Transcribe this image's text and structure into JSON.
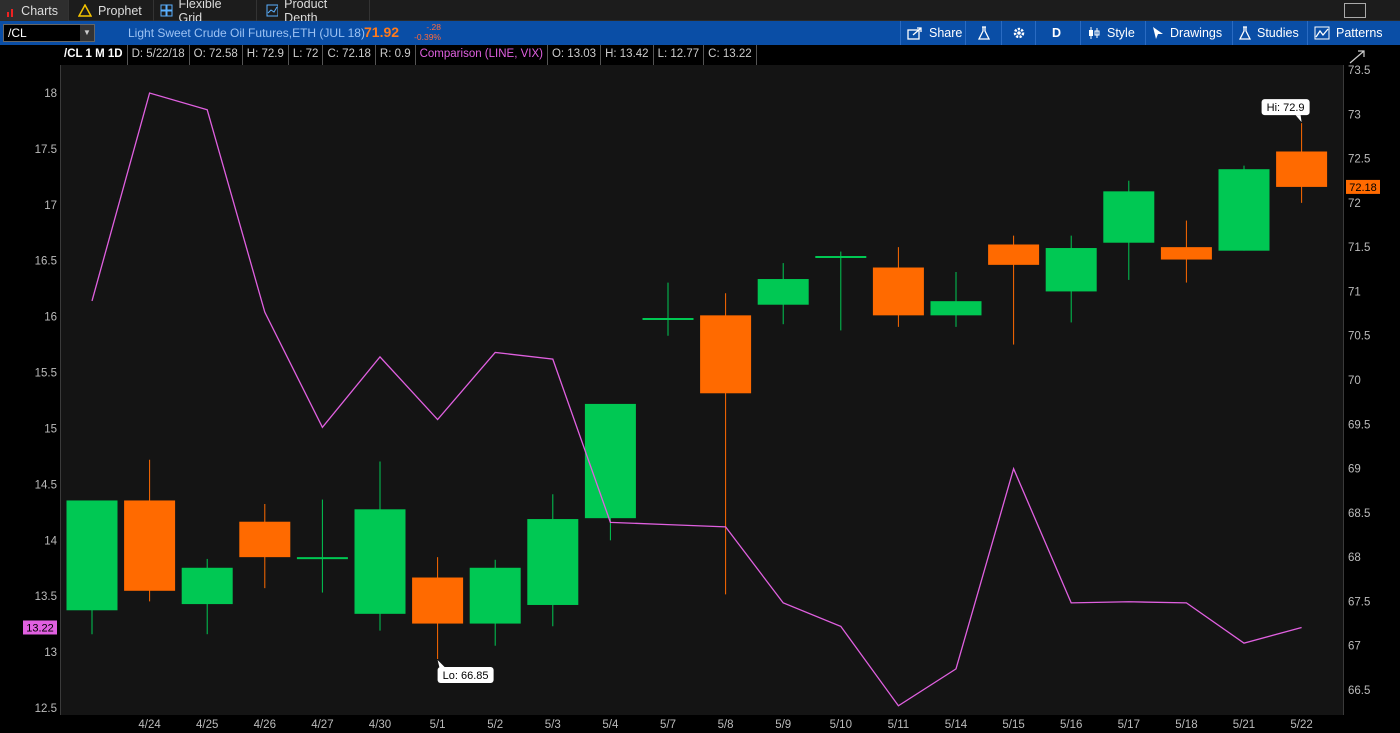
{
  "tabs": [
    {
      "label": "Charts",
      "icon": "bar-chart-icon",
      "active": true
    },
    {
      "label": "Prophet",
      "icon": "warning-triangle-icon",
      "active": false
    },
    {
      "label": "Flexible Grid",
      "icon": "grid-icon",
      "active": false
    },
    {
      "label": "Product Depth",
      "icon": "chart-icon",
      "active": false
    }
  ],
  "toolbar": {
    "symbol": "/CL",
    "description": "Light Sweet Crude Oil Futures,ETH (JUL 18)",
    "last_price": "71.92",
    "change": "-.28",
    "change_pct": "-0.39%",
    "share_label": "Share",
    "aggregation_label": "D",
    "style_label": "Style",
    "drawings_label": "Drawings",
    "studies_label": "Studies",
    "patterns_label": "Patterns"
  },
  "infobar": {
    "symbol_period": "/CL 1 M 1D",
    "date": "D: 5/22/18",
    "open": "O: 72.58",
    "high": "H: 72.9",
    "low": "L: 72",
    "close": "C: 72.18",
    "range": "R: 0.9",
    "comparison": "Comparison (LINE, VIX)",
    "cmp_open": "O: 13.03",
    "cmp_high": "H: 13.42",
    "cmp_low": "L: 12.77",
    "cmp_close": "C: 13.22"
  },
  "colors": {
    "up": "#00c853",
    "down": "#ff6a00",
    "comparison_line": "#e060e0",
    "price_tag": "#ff6a00",
    "cmp_tag": "#e060e0"
  },
  "chart_data": {
    "type": "candlestick",
    "dates": [
      "4/24",
      "4/25",
      "4/26",
      "4/27",
      "4/30",
      "5/1",
      "5/2",
      "5/3",
      "5/4",
      "5/7",
      "5/8",
      "5/9",
      "5/10",
      "5/11",
      "5/14",
      "5/15",
      "5/16",
      "5/17",
      "5/18",
      "5/21",
      "5/22"
    ],
    "ohlc": [
      [
        67.4,
        68.57,
        67.13,
        68.64
      ],
      [
        68.64,
        69.1,
        67.5,
        67.62
      ],
      [
        67.47,
        67.98,
        67.13,
        67.88
      ],
      [
        68.4,
        68.6,
        67.65,
        68.0
      ],
      [
        68.0,
        68.65,
        67.6,
        68.0
      ],
      [
        67.36,
        69.08,
        67.17,
        68.54
      ],
      [
        67.77,
        68.0,
        66.85,
        67.25
      ],
      [
        67.25,
        67.97,
        67.0,
        67.88
      ],
      [
        67.46,
        68.71,
        67.22,
        68.43
      ],
      [
        68.44,
        69.42,
        68.19,
        69.73
      ],
      [
        70.7,
        71.1,
        70.5,
        70.7
      ],
      [
        70.73,
        70.98,
        67.58,
        69.85
      ],
      [
        70.85,
        71.32,
        70.63,
        71.14
      ],
      [
        71.4,
        71.45,
        70.56,
        71.4
      ],
      [
        71.27,
        71.5,
        70.6,
        70.73
      ],
      [
        70.73,
        71.22,
        70.6,
        70.89
      ],
      [
        71.53,
        71.63,
        70.4,
        71.3
      ],
      [
        71.0,
        71.63,
        70.65,
        71.49
      ],
      [
        71.55,
        72.25,
        71.13,
        72.13
      ],
      [
        71.5,
        71.8,
        71.1,
        71.36
      ],
      [
        71.46,
        72.42,
        71.46,
        72.38
      ],
      [
        72.58,
        72.9,
        72.0,
        72.18
      ]
    ],
    "comparison": {
      "name": "VIX",
      "values": [
        16.14,
        18.0,
        17.85,
        16.04,
        15.01,
        15.64,
        15.08,
        15.68,
        15.62,
        14.16,
        14.14,
        14.12,
        13.44,
        13.23,
        12.52,
        12.85,
        14.64,
        13.44,
        13.45,
        13.44,
        13.08,
        13.22
      ]
    },
    "left_axis_ticks": [
      "18",
      "17.5",
      "17",
      "16.5",
      "16",
      "15.5",
      "15",
      "14.5",
      "14",
      "13.5",
      "13",
      "12.5"
    ],
    "right_axis_ticks": [
      "73.5",
      "73",
      "72.5",
      "72",
      "71.5",
      "71",
      "70.5",
      "70",
      "69.5",
      "69",
      "68.5",
      "68",
      "67.5",
      "67",
      "66.5"
    ],
    "left_ylim": [
      12.5,
      18.0
    ],
    "right_ylim": [
      66.5,
      73.5
    ],
    "hi_label": "Hi: 72.9",
    "lo_label": "Lo: 66.85",
    "last_tag": "72.18",
    "cmp_tag": "13.22"
  }
}
